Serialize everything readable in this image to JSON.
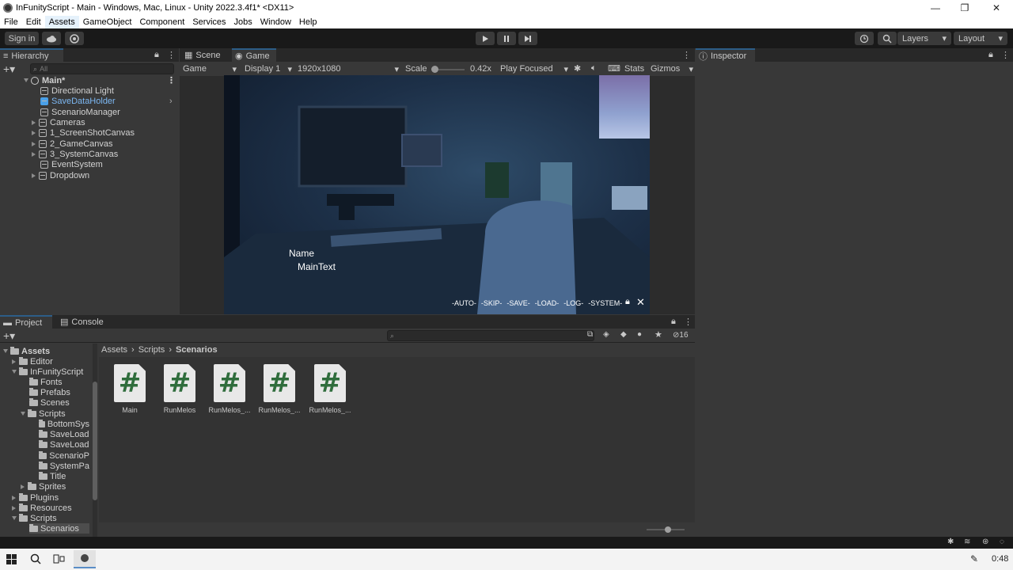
{
  "window": {
    "title": "InFunityScript - Main - Windows, Mac, Linux - Unity 2022.3.4f1* <DX11>",
    "controls": [
      "—",
      "❐",
      "✕"
    ]
  },
  "menu": [
    "File",
    "Edit",
    "Assets",
    "GameObject",
    "Component",
    "Services",
    "Jobs",
    "Window",
    "Help"
  ],
  "toolbar": {
    "sign_in": "Sign in",
    "layers": "Layers",
    "layout": "Layout"
  },
  "hierarchy": {
    "tab": "Hierarchy",
    "search_placeholder": "All",
    "scene": "Main*",
    "items": [
      {
        "label": "Directional Light"
      },
      {
        "label": "SaveDataHolder"
      },
      {
        "label": "ScenarioManager"
      },
      {
        "label": "Cameras"
      },
      {
        "label": "1_ScreenShotCanvas"
      },
      {
        "label": "2_GameCanvas"
      },
      {
        "label": "3_SystemCanvas"
      },
      {
        "label": "EventSystem"
      },
      {
        "label": "Dropdown"
      }
    ]
  },
  "game": {
    "tabs": [
      "Scene",
      "Game"
    ],
    "mode": "Game",
    "display": "Display 1",
    "resolution": "1920x1080",
    "scale_label": "Scale",
    "scale_value": "0.42x",
    "play_mode": "Play Focused",
    "stats": "Stats",
    "gizmos": "Gizmos",
    "name_text": "Name",
    "main_text": "MainText",
    "menu_items": [
      "-AUTO-",
      "-SKIP-",
      "-SAVE-",
      "-LOAD-",
      "-LOG-",
      "-SYSTEM-"
    ]
  },
  "inspector": {
    "tab": "Inspector"
  },
  "project": {
    "tabs": [
      "Project",
      "Console"
    ],
    "breadcrumb": [
      "Assets",
      "Scripts",
      "Scenarios"
    ],
    "hidden_count": "16",
    "tree": [
      {
        "label": "Assets"
      },
      {
        "label": "Editor"
      },
      {
        "label": "InFunityScript"
      },
      {
        "label": "Fonts"
      },
      {
        "label": "Prefabs"
      },
      {
        "label": "Scenes"
      },
      {
        "label": "Scripts"
      },
      {
        "label": "BottomSys"
      },
      {
        "label": "SaveLoad"
      },
      {
        "label": "SaveLoad"
      },
      {
        "label": "ScenarioP"
      },
      {
        "label": "SystemPa"
      },
      {
        "label": "Title"
      },
      {
        "label": "Sprites"
      },
      {
        "label": "Plugins"
      },
      {
        "label": "Resources"
      },
      {
        "label": "Scripts"
      },
      {
        "label": "Scenarios"
      }
    ],
    "assets": [
      {
        "label": "Main",
        "glyph": "#"
      },
      {
        "label": "RunMelos",
        "glyph": "#"
      },
      {
        "label": "RunMelos_...",
        "glyph": "#"
      },
      {
        "label": "RunMelos_...",
        "glyph": "#"
      },
      {
        "label": "RunMelos_...",
        "glyph": "#"
      }
    ]
  },
  "taskbar": {
    "clock": "0:48"
  },
  "colors": {
    "accent": "#2c5d87",
    "selected_text": "#7cb7f2",
    "script_icon": "#2f6d3c"
  }
}
